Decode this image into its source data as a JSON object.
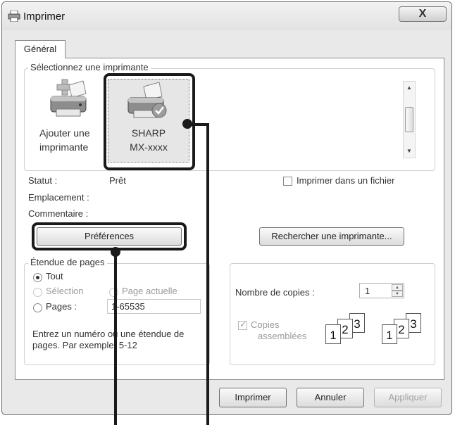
{
  "window": {
    "title": "Imprimer",
    "close_label": "X"
  },
  "tabs": [
    {
      "label": "Général"
    }
  ],
  "printer_group": {
    "label": "Sélectionnez une imprimante",
    "printers": [
      {
        "line1": "Ajouter une",
        "line2": "imprimante"
      },
      {
        "line1": "SHARP",
        "line2": "MX-xxxx"
      }
    ]
  },
  "status": {
    "status_label": "Statut :",
    "status_value": "Prêt",
    "location_label": "Emplacement :",
    "comment_label": "Commentaire :"
  },
  "print_to_file_label": "Imprimer dans un fichier",
  "preferences_label": "Préférences",
  "find_printer_label": "Rechercher une imprimante...",
  "page_range": {
    "label": "Étendue de pages",
    "all": "Tout",
    "selection": "Sélection",
    "current_page": "Page actuelle",
    "pages": "Pages :",
    "pages_value": "1-65535",
    "hint": "Entrez un numéro ou une étendue de pages. Par exemple, 5-12"
  },
  "copies": {
    "count_label": "Nombre de copies :",
    "count_value": "1",
    "collate_line1": "Copies",
    "collate_line2": "assemblées",
    "collate_glyphs": [
      "1",
      "2",
      "3",
      "1",
      "2",
      "3"
    ]
  },
  "footer": {
    "print": "Imprimer",
    "cancel": "Annuler",
    "apply": "Appliquer"
  }
}
